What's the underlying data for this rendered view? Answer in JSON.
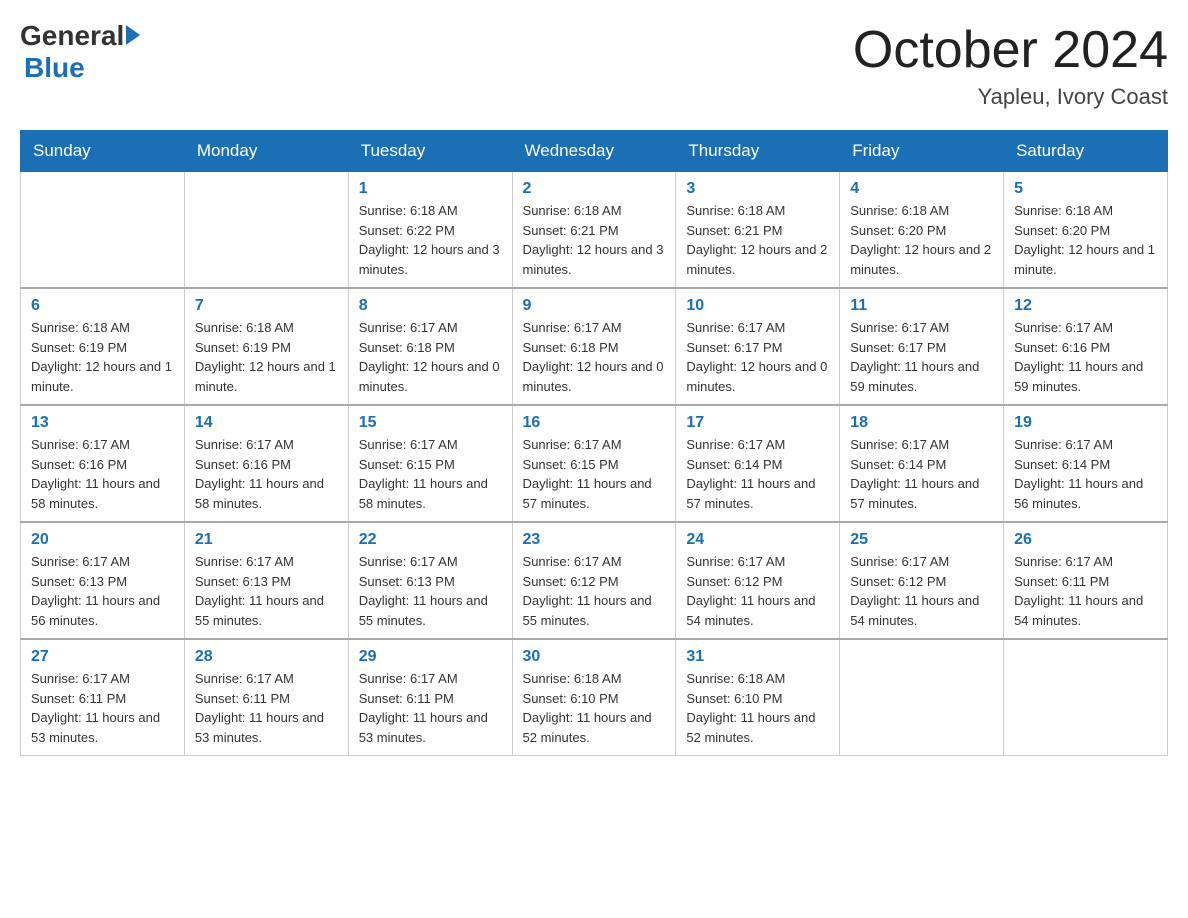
{
  "header": {
    "logo": {
      "general": "General",
      "blue": "Blue"
    },
    "title": "October 2024",
    "location": "Yapleu, Ivory Coast"
  },
  "weekdays": [
    "Sunday",
    "Monday",
    "Tuesday",
    "Wednesday",
    "Thursday",
    "Friday",
    "Saturday"
  ],
  "weeks": [
    [
      {
        "day": "",
        "info": ""
      },
      {
        "day": "",
        "info": ""
      },
      {
        "day": "1",
        "info": "Sunrise: 6:18 AM\nSunset: 6:22 PM\nDaylight: 12 hours and 3 minutes."
      },
      {
        "day": "2",
        "info": "Sunrise: 6:18 AM\nSunset: 6:21 PM\nDaylight: 12 hours and 3 minutes."
      },
      {
        "day": "3",
        "info": "Sunrise: 6:18 AM\nSunset: 6:21 PM\nDaylight: 12 hours and 2 minutes."
      },
      {
        "day": "4",
        "info": "Sunrise: 6:18 AM\nSunset: 6:20 PM\nDaylight: 12 hours and 2 minutes."
      },
      {
        "day": "5",
        "info": "Sunrise: 6:18 AM\nSunset: 6:20 PM\nDaylight: 12 hours and 1 minute."
      }
    ],
    [
      {
        "day": "6",
        "info": "Sunrise: 6:18 AM\nSunset: 6:19 PM\nDaylight: 12 hours and 1 minute."
      },
      {
        "day": "7",
        "info": "Sunrise: 6:18 AM\nSunset: 6:19 PM\nDaylight: 12 hours and 1 minute."
      },
      {
        "day": "8",
        "info": "Sunrise: 6:17 AM\nSunset: 6:18 PM\nDaylight: 12 hours and 0 minutes."
      },
      {
        "day": "9",
        "info": "Sunrise: 6:17 AM\nSunset: 6:18 PM\nDaylight: 12 hours and 0 minutes."
      },
      {
        "day": "10",
        "info": "Sunrise: 6:17 AM\nSunset: 6:17 PM\nDaylight: 12 hours and 0 minutes."
      },
      {
        "day": "11",
        "info": "Sunrise: 6:17 AM\nSunset: 6:17 PM\nDaylight: 11 hours and 59 minutes."
      },
      {
        "day": "12",
        "info": "Sunrise: 6:17 AM\nSunset: 6:16 PM\nDaylight: 11 hours and 59 minutes."
      }
    ],
    [
      {
        "day": "13",
        "info": "Sunrise: 6:17 AM\nSunset: 6:16 PM\nDaylight: 11 hours and 58 minutes."
      },
      {
        "day": "14",
        "info": "Sunrise: 6:17 AM\nSunset: 6:16 PM\nDaylight: 11 hours and 58 minutes."
      },
      {
        "day": "15",
        "info": "Sunrise: 6:17 AM\nSunset: 6:15 PM\nDaylight: 11 hours and 58 minutes."
      },
      {
        "day": "16",
        "info": "Sunrise: 6:17 AM\nSunset: 6:15 PM\nDaylight: 11 hours and 57 minutes."
      },
      {
        "day": "17",
        "info": "Sunrise: 6:17 AM\nSunset: 6:14 PM\nDaylight: 11 hours and 57 minutes."
      },
      {
        "day": "18",
        "info": "Sunrise: 6:17 AM\nSunset: 6:14 PM\nDaylight: 11 hours and 57 minutes."
      },
      {
        "day": "19",
        "info": "Sunrise: 6:17 AM\nSunset: 6:14 PM\nDaylight: 11 hours and 56 minutes."
      }
    ],
    [
      {
        "day": "20",
        "info": "Sunrise: 6:17 AM\nSunset: 6:13 PM\nDaylight: 11 hours and 56 minutes."
      },
      {
        "day": "21",
        "info": "Sunrise: 6:17 AM\nSunset: 6:13 PM\nDaylight: 11 hours and 55 minutes."
      },
      {
        "day": "22",
        "info": "Sunrise: 6:17 AM\nSunset: 6:13 PM\nDaylight: 11 hours and 55 minutes."
      },
      {
        "day": "23",
        "info": "Sunrise: 6:17 AM\nSunset: 6:12 PM\nDaylight: 11 hours and 55 minutes."
      },
      {
        "day": "24",
        "info": "Sunrise: 6:17 AM\nSunset: 6:12 PM\nDaylight: 11 hours and 54 minutes."
      },
      {
        "day": "25",
        "info": "Sunrise: 6:17 AM\nSunset: 6:12 PM\nDaylight: 11 hours and 54 minutes."
      },
      {
        "day": "26",
        "info": "Sunrise: 6:17 AM\nSunset: 6:11 PM\nDaylight: 11 hours and 54 minutes."
      }
    ],
    [
      {
        "day": "27",
        "info": "Sunrise: 6:17 AM\nSunset: 6:11 PM\nDaylight: 11 hours and 53 minutes."
      },
      {
        "day": "28",
        "info": "Sunrise: 6:17 AM\nSunset: 6:11 PM\nDaylight: 11 hours and 53 minutes."
      },
      {
        "day": "29",
        "info": "Sunrise: 6:17 AM\nSunset: 6:11 PM\nDaylight: 11 hours and 53 minutes."
      },
      {
        "day": "30",
        "info": "Sunrise: 6:18 AM\nSunset: 6:10 PM\nDaylight: 11 hours and 52 minutes."
      },
      {
        "day": "31",
        "info": "Sunrise: 6:18 AM\nSunset: 6:10 PM\nDaylight: 11 hours and 52 minutes."
      },
      {
        "day": "",
        "info": ""
      },
      {
        "day": "",
        "info": ""
      }
    ]
  ]
}
